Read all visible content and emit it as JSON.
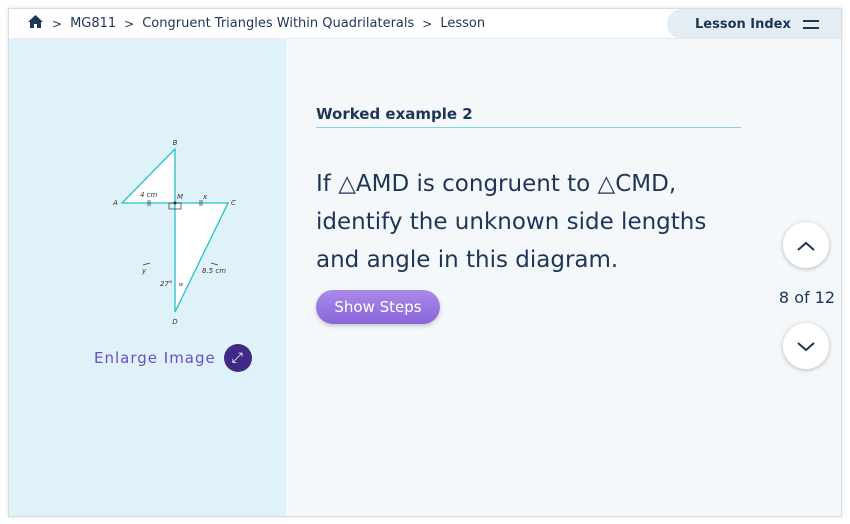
{
  "breadcrumb": {
    "home_icon": "home-icon",
    "items": [
      "MG811",
      "Congruent Triangles Within Quadrilaterals",
      "Lesson"
    ]
  },
  "lesson_index": {
    "label": "Lesson Index",
    "icon": "menu-icon"
  },
  "diagram": {
    "points": {
      "A": "A",
      "B": "B",
      "C": "C",
      "D": "D",
      "M": "M"
    },
    "labels": {
      "am": "4 cm",
      "mc": "x",
      "ad": "y",
      "cd": "8.5 cm",
      "angle_adm": "27°",
      "angle_cdm": "w"
    }
  },
  "enlarge": {
    "label": "Enlarge Image",
    "icon": "expand-icon"
  },
  "main": {
    "heading": "Worked example 2",
    "question": "If △AMD is congruent to △CMD, identify the unknown side lengths and angle in this diagram.",
    "show_steps": "Show Steps"
  },
  "pager": {
    "text": "8 of 12",
    "up_icon": "chevron-up-icon",
    "down_icon": "chevron-down-icon"
  },
  "colors": {
    "accent": "#8a66d9",
    "diagram": "#21c3c9",
    "text": "#1d3557"
  }
}
